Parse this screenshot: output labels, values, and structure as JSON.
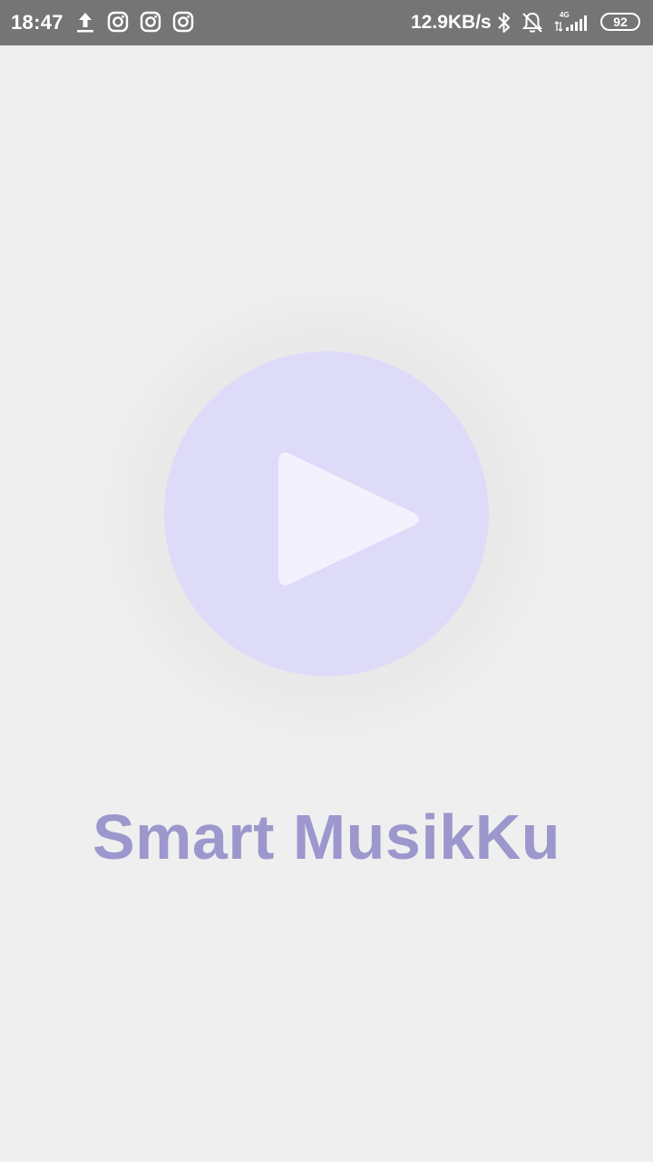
{
  "status_bar": {
    "time": "18:47",
    "network_speed": "12.9KB/s",
    "network_type": "4G",
    "battery_level": "92",
    "icons": [
      "upload-icon",
      "instagram-icon",
      "instagram-icon",
      "instagram-icon",
      "bluetooth-icon",
      "notifications-off-icon",
      "signal-icon",
      "battery-icon"
    ]
  },
  "splash": {
    "app_name": "Smart MusikKu",
    "play_icon": "play-icon"
  },
  "colors": {
    "status_bar_bg": "#757575",
    "background": "#efefef",
    "play_circle": "#dedbf9",
    "play_triangle": "#f2f1fd",
    "title_text": "#9c97cc"
  }
}
